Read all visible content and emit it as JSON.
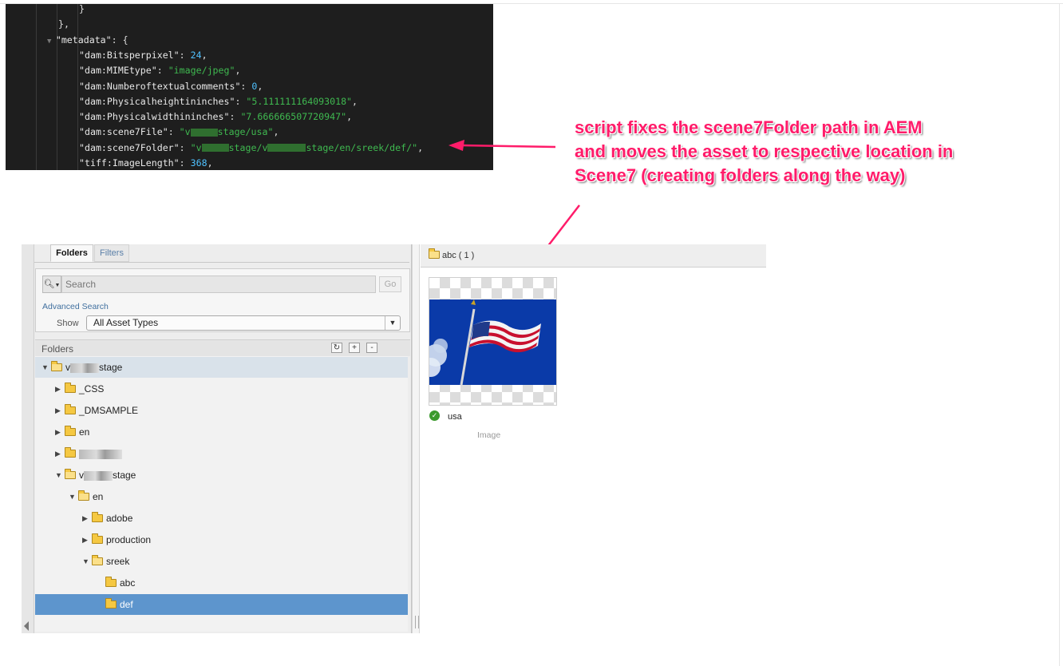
{
  "code": {
    "lines": [
      {
        "indent": 3,
        "tokens": [
          {
            "t": "}",
            "c": "p"
          }
        ]
      },
      {
        "indent": 2,
        "tokens": [
          {
            "t": "},",
            "c": "p"
          }
        ]
      },
      {
        "indent": 2,
        "toggle": true,
        "tokens": [
          {
            "t": "\"metadata\"",
            "c": "k"
          },
          {
            "t": ": {",
            "c": "p"
          }
        ]
      },
      {
        "indent": 3,
        "tokens": [
          {
            "t": "\"dam:Bitsperpixel\"",
            "c": "k"
          },
          {
            "t": ": ",
            "c": "p"
          },
          {
            "t": "24",
            "c": "n"
          },
          {
            "t": ",",
            "c": "p"
          }
        ]
      },
      {
        "indent": 3,
        "tokens": [
          {
            "t": "\"dam:MIMEtype\"",
            "c": "k"
          },
          {
            "t": ": ",
            "c": "p"
          },
          {
            "t": "\"image/jpeg\"",
            "c": "s"
          },
          {
            "t": ",",
            "c": "p"
          }
        ]
      },
      {
        "indent": 3,
        "tokens": [
          {
            "t": "\"dam:Numberoftextualcomments\"",
            "c": "k"
          },
          {
            "t": ": ",
            "c": "p"
          },
          {
            "t": "0",
            "c": "n"
          },
          {
            "t": ",",
            "c": "p"
          }
        ]
      },
      {
        "indent": 3,
        "tokens": [
          {
            "t": "\"dam:Physicalheightininches\"",
            "c": "k"
          },
          {
            "t": ": ",
            "c": "p"
          },
          {
            "t": "\"5.111111164093018\"",
            "c": "s"
          },
          {
            "t": ",",
            "c": "p"
          }
        ]
      },
      {
        "indent": 3,
        "tokens": [
          {
            "t": "\"dam:Physicalwidthininches\"",
            "c": "k"
          },
          {
            "t": ": ",
            "c": "p"
          },
          {
            "t": "\"7.666666507720947\"",
            "c": "s"
          },
          {
            "t": ",",
            "c": "p"
          }
        ]
      },
      {
        "indent": 3,
        "tokens": [
          {
            "t": "\"dam:scene7File\"",
            "c": "k"
          },
          {
            "t": ": ",
            "c": "p"
          },
          {
            "t": "\"v",
            "c": "s"
          },
          {
            "blur": 34
          },
          {
            "t": "stage/usa\"",
            "c": "s"
          },
          {
            "t": ",",
            "c": "p"
          }
        ]
      },
      {
        "indent": 3,
        "tokens": [
          {
            "t": "\"dam:scene7Folder\"",
            "c": "k"
          },
          {
            "t": ": ",
            "c": "p"
          },
          {
            "t": "\"v",
            "c": "s"
          },
          {
            "blur": 34
          },
          {
            "t": "stage/v",
            "c": "s"
          },
          {
            "blur": 48
          },
          {
            "t": "stage/en/sreek/def/\"",
            "c": "s"
          },
          {
            "t": ",",
            "c": "p"
          }
        ]
      },
      {
        "indent": 3,
        "tokens": [
          {
            "t": "\"tiff:ImageLength\"",
            "c": "k"
          },
          {
            "t": ": ",
            "c": "p"
          },
          {
            "t": "368",
            "c": "n"
          },
          {
            "t": ",",
            "c": "p"
          }
        ]
      }
    ]
  },
  "annotation": {
    "lines": [
      "script fixes the scene7Folder path in AEM",
      "and moves the asset to respective location in",
      "Scene7 (creating folders along the way)"
    ],
    "color": "#ff1c6a"
  },
  "left_panel": {
    "tabs": {
      "folders": "Folders",
      "filters": "Filters"
    },
    "search": {
      "placeholder": "Search",
      "go": "Go",
      "advanced": "Advanced Search"
    },
    "show": {
      "label": "Show",
      "value": "All Asset Types"
    },
    "folders_title": "Folders",
    "header_buttons": {
      "refresh": "↻",
      "add": "+",
      "remove": "-"
    },
    "tree": [
      {
        "label": "stage",
        "level": 0,
        "expanded": true,
        "prefix": "v",
        "redact": 36,
        "state": "root"
      },
      {
        "label": "_CSS",
        "level": 1,
        "expanded": false
      },
      {
        "label": "_DMSAMPLE",
        "level": 1,
        "expanded": false
      },
      {
        "label": "en",
        "level": 1,
        "expanded": false
      },
      {
        "label": "",
        "level": 1,
        "expanded": false,
        "redact": 54
      },
      {
        "label": "stage",
        "level": 1,
        "expanded": true,
        "prefix": "v",
        "redact": 36
      },
      {
        "label": "en",
        "level": 2,
        "expanded": true
      },
      {
        "label": "adobe",
        "level": 3,
        "expanded": false
      },
      {
        "label": "production",
        "level": 3,
        "expanded": false
      },
      {
        "label": "sreek",
        "level": 3,
        "expanded": true
      },
      {
        "label": "abc",
        "level": 4,
        "leaf": true
      },
      {
        "label": "def",
        "level": 4,
        "leaf": true,
        "state": "selected"
      }
    ]
  },
  "right_panel": {
    "title": "abc ( 1 )",
    "asset": {
      "name": "usa",
      "type": "Image",
      "status": "published-check-icon"
    }
  }
}
